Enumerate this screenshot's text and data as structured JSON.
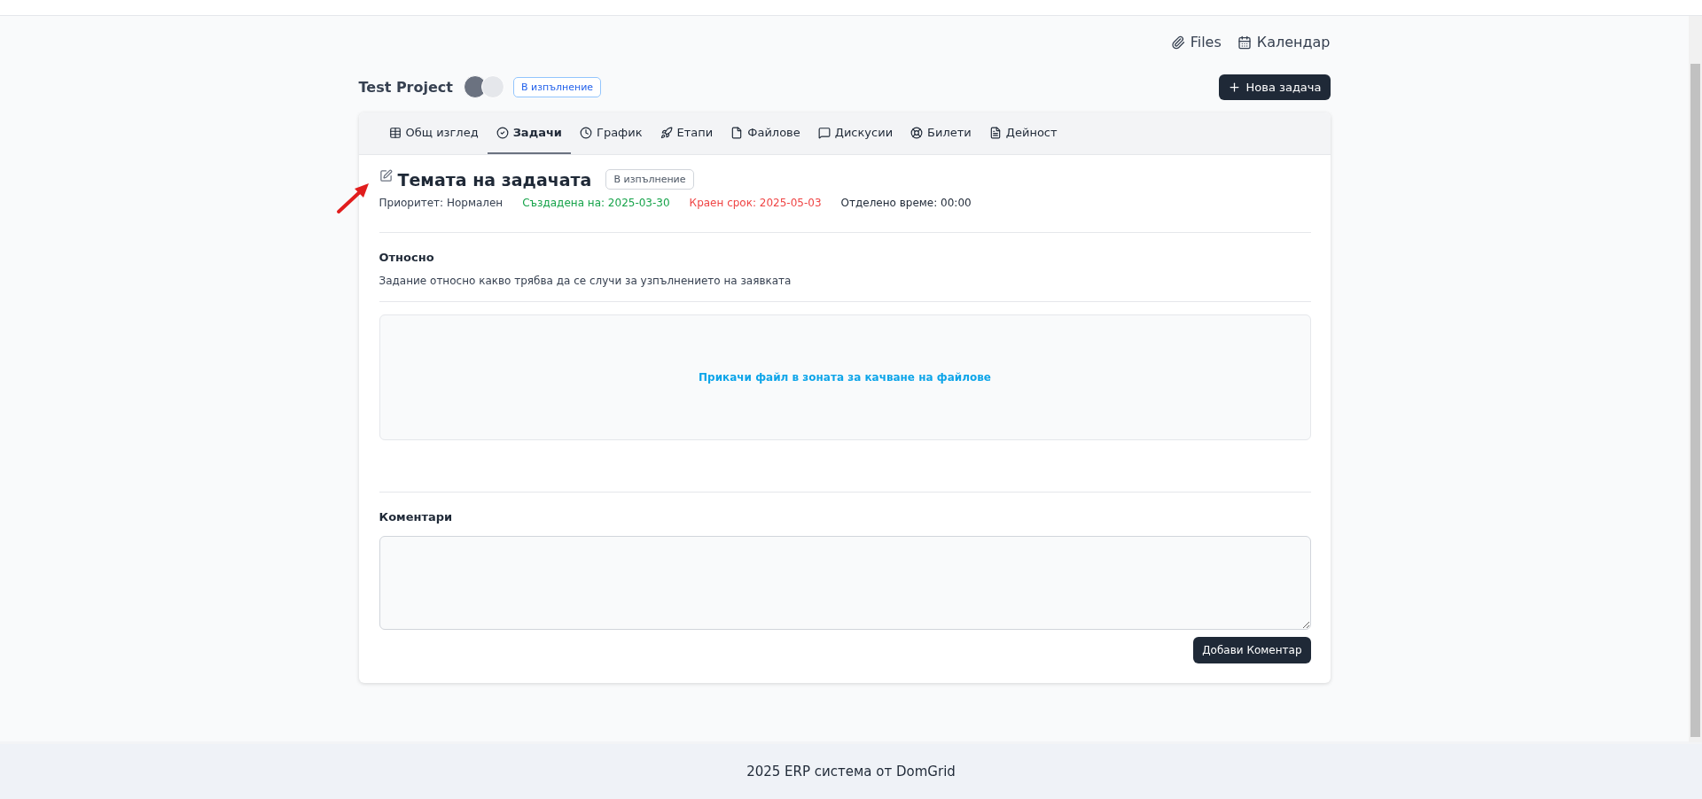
{
  "top_links": [
    {
      "label": "Files"
    },
    {
      "label": "Календар"
    }
  ],
  "project": {
    "title": "Test Project",
    "status": "В изпълнение",
    "new_task_button": "Нова задача"
  },
  "tabs": [
    {
      "label": "Общ изглед",
      "selected": false
    },
    {
      "label": "Задачи",
      "selected": true
    },
    {
      "label": "График",
      "selected": false
    },
    {
      "label": "Етапи",
      "selected": false
    },
    {
      "label": "Файлове",
      "selected": false
    },
    {
      "label": "Дискусии",
      "selected": false
    },
    {
      "label": "Билети",
      "selected": false
    },
    {
      "label": "Дейност",
      "selected": false
    }
  ],
  "task": {
    "title": "Темата на задачата",
    "status": "В изпълнение",
    "meta": [
      {
        "text": "Приоритет: Нормален",
        "color": "#374151"
      },
      {
        "text": "Създадена на: 2025-03-30",
        "color": "#16a34a"
      },
      {
        "text": "Краен срок: 2025-05-03",
        "color": "#ef4444"
      },
      {
        "text": "Отделено време: 00:00",
        "color": "#1f2937"
      }
    ],
    "about_heading": "Относно",
    "about_text": "Задание относно какво трябва да се случи за узпълнението на заявката",
    "dropzone": "Прикачи файл в зоната за качване на файлове",
    "comments_heading": "Коментари",
    "comment_button": "Добави Коментар"
  },
  "footer": "2025 ERP система от DomGrid"
}
